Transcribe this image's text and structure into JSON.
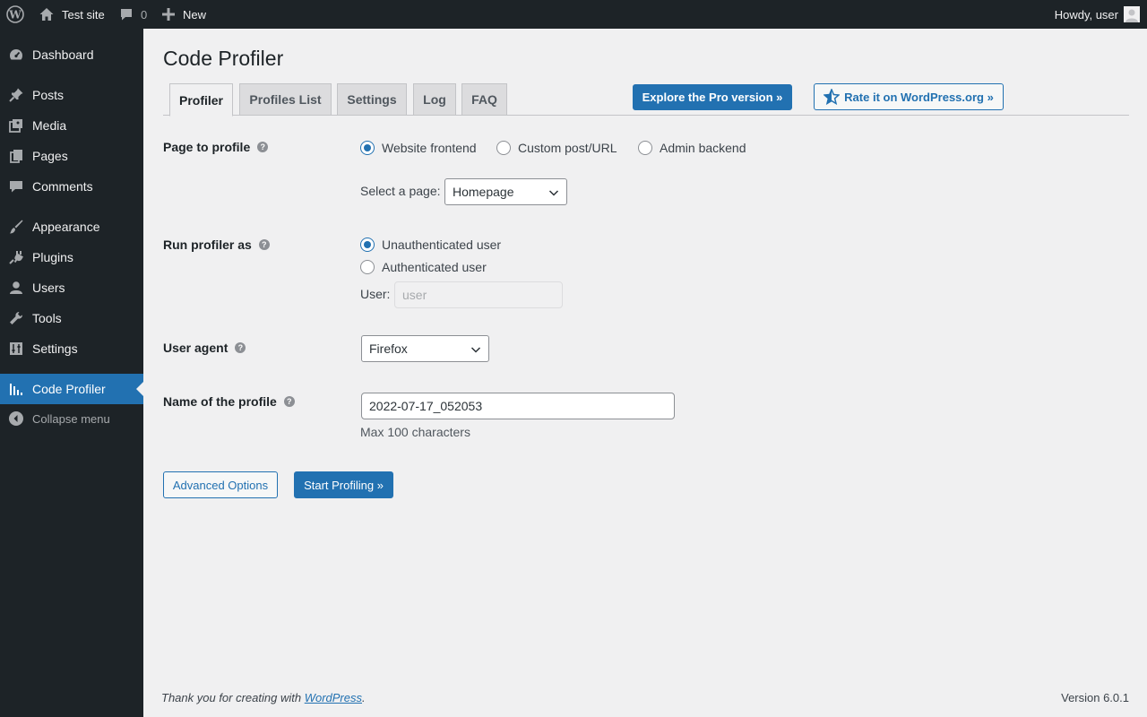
{
  "adminbar": {
    "site_name": "Test site",
    "comments_count": "0",
    "new_label": "New",
    "howdy": "Howdy, user"
  },
  "sidebar": {
    "items": [
      {
        "label": "Dashboard",
        "icon": "dashboard-icon"
      },
      {
        "label": "Posts",
        "icon": "pin-icon"
      },
      {
        "label": "Media",
        "icon": "media-icon"
      },
      {
        "label": "Pages",
        "icon": "pages-icon"
      },
      {
        "label": "Comments",
        "icon": "comment-icon"
      },
      {
        "label": "Appearance",
        "icon": "brush-icon"
      },
      {
        "label": "Plugins",
        "icon": "plug-icon"
      },
      {
        "label": "Users",
        "icon": "user-icon"
      },
      {
        "label": "Tools",
        "icon": "wrench-icon"
      },
      {
        "label": "Settings",
        "icon": "sliders-icon"
      },
      {
        "label": "Code Profiler",
        "icon": "chart-icon",
        "current": true
      }
    ],
    "collapse_label": "Collapse menu"
  },
  "page": {
    "title": "Code Profiler",
    "tabs": [
      "Profiler",
      "Profiles List",
      "Settings",
      "Log",
      "FAQ"
    ],
    "active_tab": "Profiler",
    "pro_button": "Explore the Pro version »",
    "rate_button": "Rate it on WordPress.org »"
  },
  "form": {
    "page_to_profile": {
      "label": "Page to profile",
      "options": [
        "Website frontend",
        "Custom post/URL",
        "Admin backend"
      ],
      "selected": "Website frontend",
      "select_page_label": "Select a page:",
      "select_page_value": "Homepage"
    },
    "run_as": {
      "label": "Run profiler as",
      "options": [
        "Unauthenticated user",
        "Authenticated user"
      ],
      "selected": "Unauthenticated user",
      "user_label": "User:",
      "user_value": "user"
    },
    "user_agent": {
      "label": "User agent",
      "value": "Firefox"
    },
    "profile_name": {
      "label": "Name of the profile",
      "value": "2022-07-17_052053",
      "description": "Max 100 characters"
    },
    "advanced_button": "Advanced Options",
    "start_button": "Start Profiling »"
  },
  "footer": {
    "thanks_prefix": "Thank you for creating with ",
    "thanks_link": "WordPress",
    "thanks_suffix": ".",
    "version": "Version 6.0.1"
  },
  "colors": {
    "accent": "#2271b1",
    "admin_dark": "#1d2327",
    "background": "#f0f0f1"
  }
}
